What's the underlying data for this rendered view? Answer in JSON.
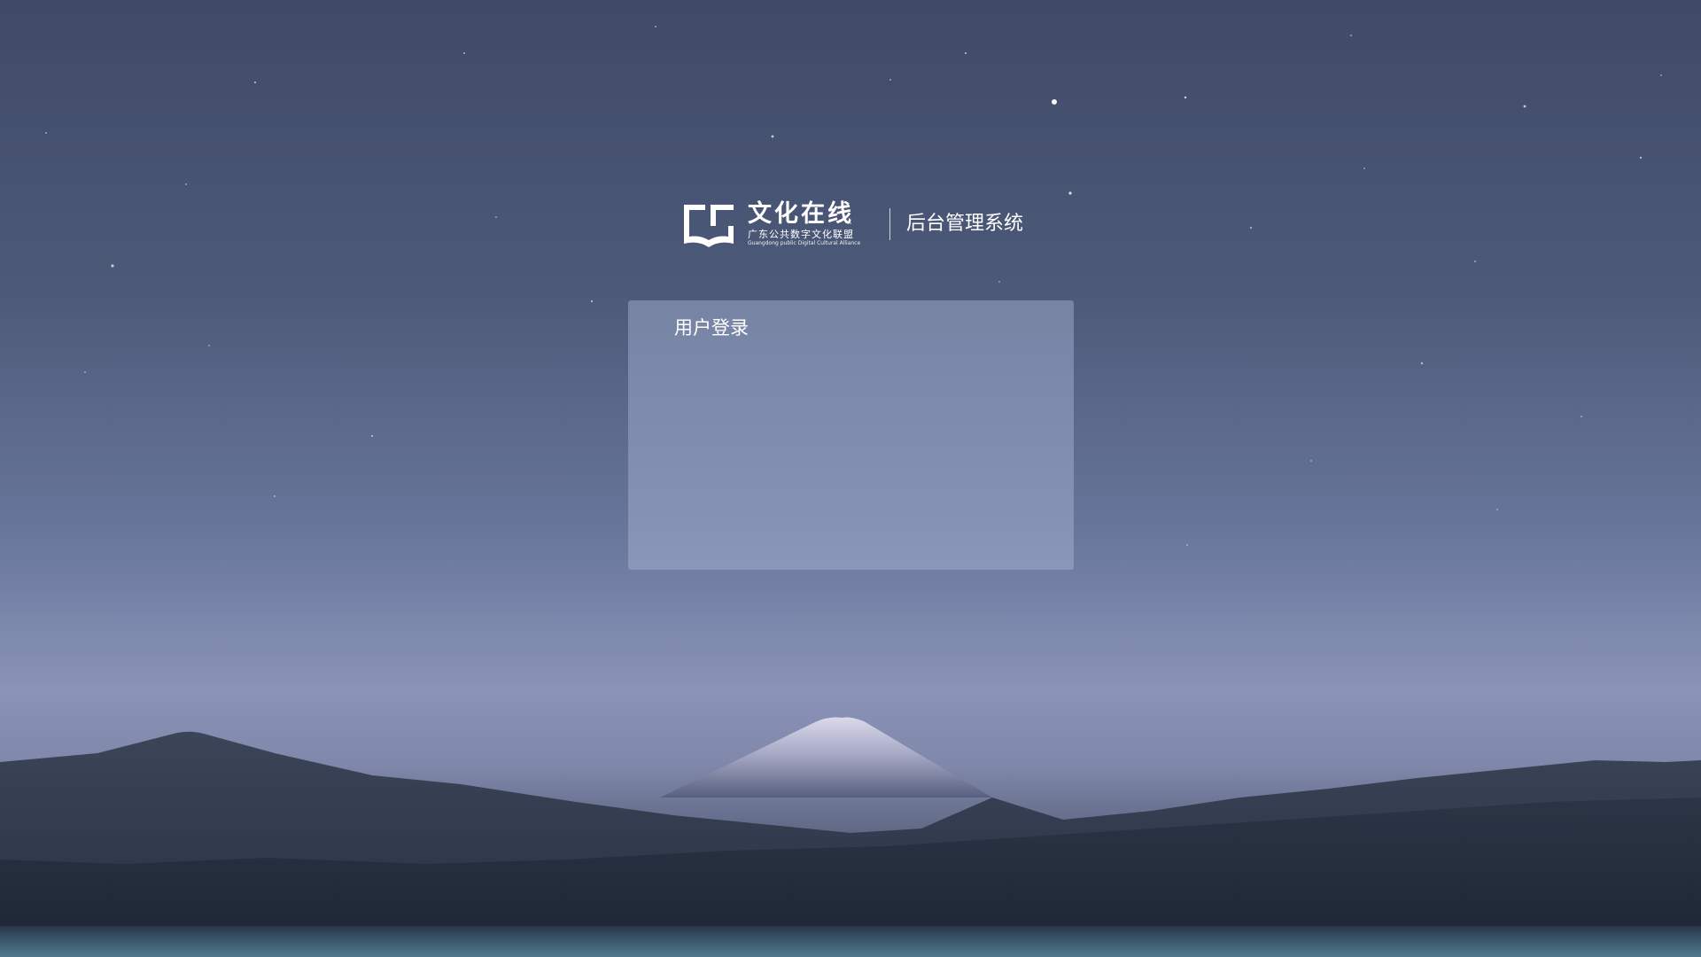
{
  "brand": {
    "logo_title": "文化在线",
    "logo_subtitle": "广东公共数字文化联盟",
    "logo_english": "Guangdong public Digital Cultural Alliance",
    "system_name": "后台管理系统",
    "logo_icon": "book-gc-logo-icon"
  },
  "login": {
    "title": "用户登录"
  },
  "background": {
    "description_icon": "starry-mountain-background",
    "accent_color": "#ffffff",
    "card_color": "#aab6d6"
  }
}
